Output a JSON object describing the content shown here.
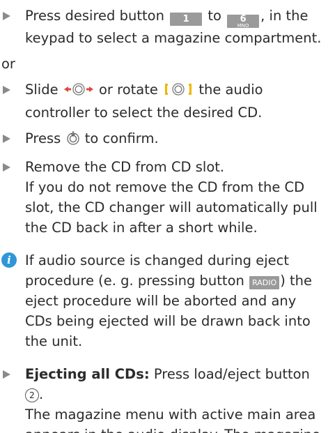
{
  "steps": [
    {
      "before": "Press desired button",
      "key_from": {
        "digit": "1",
        "letters": ""
      },
      "mid": "to",
      "key_to": {
        "digit": "6",
        "letters": "MNO"
      },
      "after": ", in the keypad to select a magazine compartment."
    }
  ],
  "or_text": "or",
  "slide_step": {
    "a": "Slide",
    "b": "or rotate",
    "c": "the audio controller to select the desired CD."
  },
  "confirm_step": {
    "a": "Press",
    "b": "to confirm."
  },
  "remove_step": {
    "line1": "Remove the CD from CD slot.",
    "line2": "If you do not remove the CD from the CD slot, the CD changer will automatically pull the CD back in after a short while."
  },
  "info_note": {
    "a": "If audio source is changed during eject procedure (e. g. pressing button",
    "key": "RADIO",
    "b": ") the eject procedure will be aborted and any CDs being ejected will be drawn back into the unit."
  },
  "eject_all_step": {
    "bold": "Ejecting all CDs:",
    "a": "Press load/eject button",
    "circled": "2",
    "b": ".",
    "line2": "The magazine menu with active main area appears in the audio display. The magazine"
  },
  "colors": {
    "text": "#2b2b2b",
    "bullet": "#8a8a8a",
    "keycap": "#9a9a9a",
    "info_icon": "#2f96d8",
    "controller_arrows": "#e0463c",
    "controller_brackets": "#f2b600"
  },
  "icons": [
    "triangle-bullet-icon",
    "slide-controller-icon",
    "rotate-controller-icon",
    "press-controller-icon",
    "info-icon"
  ]
}
